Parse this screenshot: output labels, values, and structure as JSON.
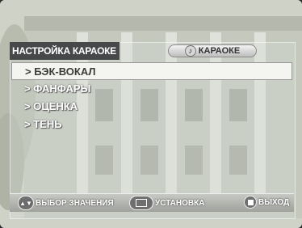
{
  "menu": {
    "title": "НАСТРОЙКА КАРАОКЕ",
    "tab_label": "КАРАОКЕ",
    "tab_icon": "music-note-icon",
    "items": [
      {
        "label": "> БЭК-ВОКАЛ",
        "selected": true
      },
      {
        "label": "> ФАНФАРЫ",
        "selected": false
      },
      {
        "label": "> ОЦЕНКА",
        "selected": false
      },
      {
        "label": "> ТЕНЬ",
        "selected": false
      }
    ]
  },
  "footer": {
    "select_label": "ВЫБОР ЗНАЧЕНИЯ",
    "set_label": "УСТАНОВКА",
    "exit_label": "ВЫХОД"
  },
  "colors": {
    "title_bg": "#46484a",
    "selected_bg": "#f4f4f0",
    "text": "#ffffff"
  }
}
